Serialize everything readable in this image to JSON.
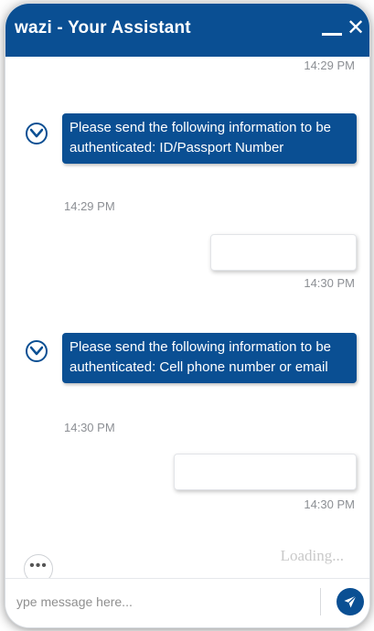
{
  "header": {
    "title": "wazi - Your Assistant",
    "minimize_symbol": "—",
    "close_symbol": "✕"
  },
  "messages": {
    "top_timestamp": "14:29 PM",
    "bot_1": {
      "text": "Please send the following information to be authenticated: ID/Passport Number",
      "timestamp": "14:29 PM"
    },
    "user_1": {
      "text": "",
      "timestamp": "14:30 PM"
    },
    "bot_2": {
      "text": "Please send the following information to be authenticated: Cell phone number or email",
      "timestamp": "14:30 PM"
    },
    "user_2": {
      "text": "",
      "timestamp": "14:30 PM"
    }
  },
  "status": {
    "loading": "Loading..."
  },
  "composer": {
    "more_label": "•••",
    "placeholder": "ype message here...",
    "send_icon": "send-icon"
  },
  "colors": {
    "primary": "#0a4f93",
    "bubble_text": "#ffffff",
    "timestamp": "#8c8f94"
  }
}
